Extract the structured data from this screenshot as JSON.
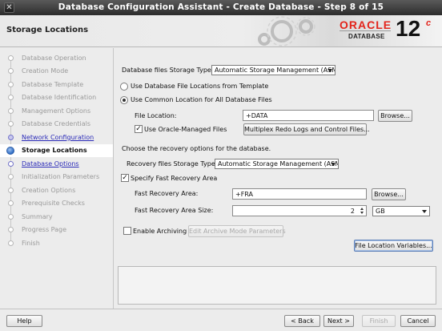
{
  "window": {
    "title": "Database Configuration Assistant - Create Database - Step 8 of 15",
    "close_glyph": "✕"
  },
  "header": {
    "page_title": "Storage Locations",
    "logo": {
      "oracle": "ORACLE",
      "database": "DATABASE",
      "version": "12",
      "version_sup": "c"
    }
  },
  "nav": {
    "items": [
      {
        "label": "Database Operation",
        "state": "done-disabled"
      },
      {
        "label": "Creation Mode",
        "state": "done-disabled"
      },
      {
        "label": "Database Template",
        "state": "done-disabled"
      },
      {
        "label": "Database Identification",
        "state": "done-disabled"
      },
      {
        "label": "Management Options",
        "state": "done-disabled"
      },
      {
        "label": "Database Credentials",
        "state": "done-disabled"
      },
      {
        "label": "Network Configuration",
        "state": "done"
      },
      {
        "label": "Storage Locations",
        "state": "current"
      },
      {
        "label": "Database Options",
        "state": "next"
      },
      {
        "label": "Initialization Parameters",
        "state": "pending"
      },
      {
        "label": "Creation Options",
        "state": "pending"
      },
      {
        "label": "Prerequisite Checks",
        "state": "pending"
      },
      {
        "label": "Summary",
        "state": "pending"
      },
      {
        "label": "Progress Page",
        "state": "pending"
      },
      {
        "label": "Finish",
        "state": "pending"
      }
    ]
  },
  "storage": {
    "files_type_label": "Database files Storage Type:",
    "files_type_value": "Automatic Storage Management (ASM)",
    "radio_template": "Use Database File Locations from Template",
    "radio_common": "Use Common Location for All Database Files",
    "file_location_label": "File Location:",
    "file_location_value": "+DATA",
    "browse": "Browse...",
    "omf_label": "Use Oracle-Managed Files",
    "omf_checked": true,
    "multiplex_button": "Multiplex Redo Logs and Control Files..."
  },
  "recovery": {
    "intro": "Choose the recovery options for the database.",
    "type_label": "Recovery files Storage Type:",
    "type_value": "Automatic Storage Management (ASM)",
    "specify_fra_label": "Specify Fast Recovery Area",
    "specify_fra_checked": true,
    "fra_label": "Fast Recovery Area:",
    "fra_value": "+FRA",
    "browse": "Browse...",
    "fra_size_label": "Fast Recovery Area Size:",
    "fra_size_value": "2",
    "fra_unit": "GB",
    "archiving_label": "Enable Archiving",
    "archiving_checked": false,
    "archive_params_button": "Edit Archive Mode Parameters",
    "file_location_variables_button": "File Location Variables..."
  },
  "footer": {
    "help": "Help",
    "back": "< Back",
    "next": "Next >",
    "finish": "Finish",
    "cancel": "Cancel"
  }
}
